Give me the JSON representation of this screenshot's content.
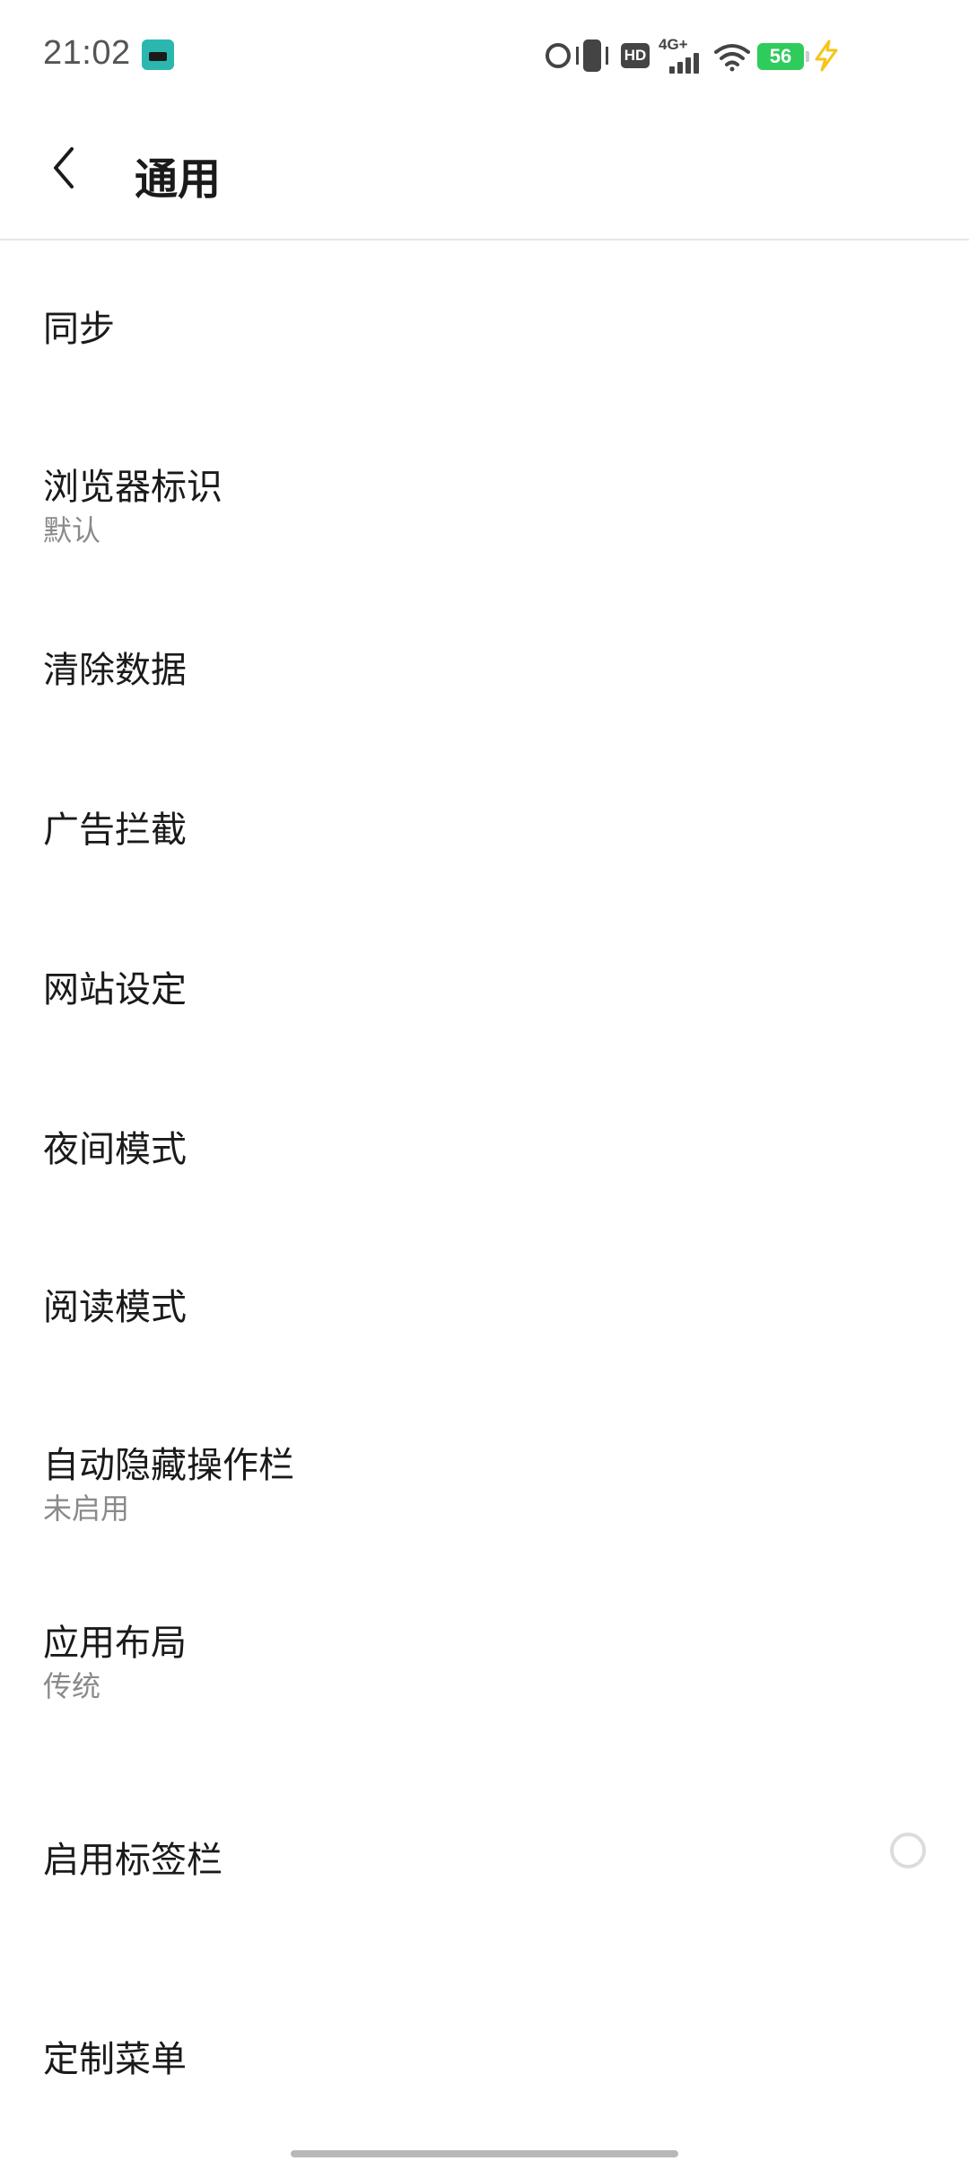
{
  "status_bar": {
    "time": "21:02",
    "hd_label": "HD",
    "network_label": "4G+",
    "battery_level": "56",
    "app_badge_icon": "app-badge-icon",
    "icons": [
      "alarm-icon",
      "vibrate-icon",
      "hd-icon",
      "signal-icon",
      "wifi-icon",
      "battery-icon",
      "charging-icon"
    ],
    "battery_color": "#2ecc5a",
    "charging_color": "#f5c518"
  },
  "header": {
    "title": "通用",
    "back_icon": "chevron-left-icon"
  },
  "items": [
    {
      "title": "同步",
      "subtitle": ""
    },
    {
      "title": "浏览器标识",
      "subtitle": "默认"
    },
    {
      "title": "清除数据",
      "subtitle": ""
    },
    {
      "title": "广告拦截",
      "subtitle": ""
    },
    {
      "title": "网站设定",
      "subtitle": ""
    },
    {
      "title": "夜间模式",
      "subtitle": ""
    },
    {
      "title": "阅读模式",
      "subtitle": ""
    },
    {
      "title": "自动隐藏操作栏",
      "subtitle": "未启用"
    },
    {
      "title": "应用布局",
      "subtitle": "传统"
    },
    {
      "title": "启用标签栏",
      "subtitle": "",
      "toggle": false
    },
    {
      "title": "定制菜单",
      "subtitle": ""
    }
  ]
}
